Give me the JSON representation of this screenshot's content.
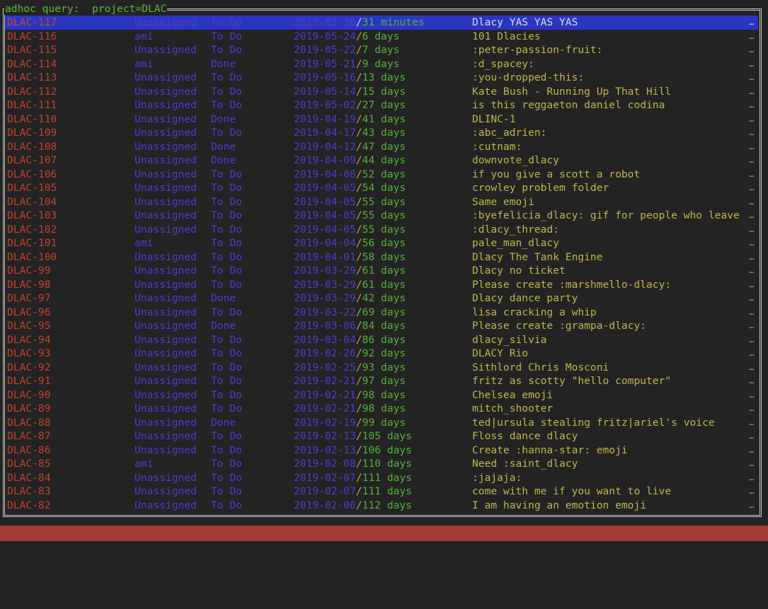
{
  "frame": {
    "title": "adhoc query:  project=DLAC"
  },
  "colors": {
    "background": "#232323",
    "border": "#c8c8c8",
    "title": "#5fb83a",
    "key": "#c4432e",
    "assignee": "#4f3bd0",
    "status": "#4f3bd0",
    "date": "#4f3bd0",
    "separator": "#b8b042",
    "age": "#54b33a",
    "summary": "#c0b64a",
    "selection": "#2a36c0",
    "statusbar": "#a33a36"
  },
  "more_glyph": "…",
  "date_separator": "/",
  "selected_index": 0,
  "issues": [
    {
      "key": "DLAC-117",
      "assignee": "Unassigned",
      "status": "To Do",
      "date": "2019-05-30",
      "age": "31 minutes",
      "summary": "Dlacy YAS YAS YAS"
    },
    {
      "key": "DLAC-116",
      "assignee": "ami",
      "status": "To Do",
      "date": "2019-05-24",
      "age": "6 days",
      "summary": "101 Dlacies"
    },
    {
      "key": "DLAC-115",
      "assignee": "Unassigned",
      "status": "To Do",
      "date": "2019-05-22",
      "age": "7 days",
      "summary": ":peter-passion-fruit:"
    },
    {
      "key": "DLAC-114",
      "assignee": "ami",
      "status": "Done",
      "date": "2019-05-21",
      "age": "9 days",
      "summary": ":d_spacey:"
    },
    {
      "key": "DLAC-113",
      "assignee": "Unassigned",
      "status": "To Do",
      "date": "2019-05-16",
      "age": "13 days",
      "summary": ":you-dropped-this:"
    },
    {
      "key": "DLAC-112",
      "assignee": "Unassigned",
      "status": "To Do",
      "date": "2019-05-14",
      "age": "15 days",
      "summary": "Kate Bush - Running Up That Hill"
    },
    {
      "key": "DLAC-111",
      "assignee": "Unassigned",
      "status": "To Do",
      "date": "2019-05-02",
      "age": "27 days",
      "summary": "is this reggaeton daniel codina"
    },
    {
      "key": "DLAC-110",
      "assignee": "Unassigned",
      "status": "Done",
      "date": "2019-04-19",
      "age": "41 days",
      "summary": "DLINC-1"
    },
    {
      "key": "DLAC-109",
      "assignee": "Unassigned",
      "status": "To Do",
      "date": "2019-04-17",
      "age": "43 days",
      "summary": ":abc_adrien:"
    },
    {
      "key": "DLAC-108",
      "assignee": "Unassigned",
      "status": "Done",
      "date": "2019-04-12",
      "age": "47 days",
      "summary": ":cutnam:"
    },
    {
      "key": "DLAC-107",
      "assignee": "Unassigned",
      "status": "Done",
      "date": "2019-04-09",
      "age": "44 days",
      "summary": "downvote_dlacy"
    },
    {
      "key": "DLAC-106",
      "assignee": "Unassigned",
      "status": "To Do",
      "date": "2019-04-08",
      "age": "52 days",
      "summary": "if you give a scott a robot"
    },
    {
      "key": "DLAC-105",
      "assignee": "Unassigned",
      "status": "To Do",
      "date": "2019-04-05",
      "age": "54 days",
      "summary": "crowley problem folder"
    },
    {
      "key": "DLAC-104",
      "assignee": "Unassigned",
      "status": "To Do",
      "date": "2019-04-05",
      "age": "55 days",
      "summary": "Same emoji"
    },
    {
      "key": "DLAC-103",
      "assignee": "Unassigned",
      "status": "To Do",
      "date": "2019-04-05",
      "age": "55 days",
      "summary": ":byefelicia_dlacy: gif for people who leave"
    },
    {
      "key": "DLAC-102",
      "assignee": "Unassigned",
      "status": "To Do",
      "date": "2019-04-05",
      "age": "55 days",
      "summary": ":dlacy_thread:"
    },
    {
      "key": "DLAC-101",
      "assignee": "ami",
      "status": "To Do",
      "date": "2019-04-04",
      "age": "56 days",
      "summary": "pale_man_dlacy"
    },
    {
      "key": "DLAC-100",
      "assignee": "Unassigned",
      "status": "To Do",
      "date": "2019-04-01",
      "age": "58 days",
      "summary": "Dlacy The Tank Engine"
    },
    {
      "key": "DLAC-99",
      "assignee": "Unassigned",
      "status": "To Do",
      "date": "2019-03-29",
      "age": "61 days",
      "summary": "Dlacy no ticket"
    },
    {
      "key": "DLAC-98",
      "assignee": "Unassigned",
      "status": "To Do",
      "date": "2019-03-29",
      "age": "61 days",
      "summary": "Please create :marshmello-dlacy:"
    },
    {
      "key": "DLAC-97",
      "assignee": "Unassigned",
      "status": "Done",
      "date": "2019-03-29",
      "age": "42 days",
      "summary": "Dlacy dance party"
    },
    {
      "key": "DLAC-96",
      "assignee": "Unassigned",
      "status": "To Do",
      "date": "2019-03-22",
      "age": "69 days",
      "summary": "lisa cracking a whip"
    },
    {
      "key": "DLAC-95",
      "assignee": "Unassigned",
      "status": "Done",
      "date": "2019-03-06",
      "age": "84 days",
      "summary": "Please create :grampa-dlacy:"
    },
    {
      "key": "DLAC-94",
      "assignee": "Unassigned",
      "status": "To Do",
      "date": "2019-03-04",
      "age": "86 days",
      "summary": "dlacy_silvia"
    },
    {
      "key": "DLAC-93",
      "assignee": "Unassigned",
      "status": "To Do",
      "date": "2019-02-26",
      "age": "92 days",
      "summary": "DLACY Rio"
    },
    {
      "key": "DLAC-92",
      "assignee": "Unassigned",
      "status": "To Do",
      "date": "2019-02-25",
      "age": "93 days",
      "summary": "Sithlord Chris Mosconi"
    },
    {
      "key": "DLAC-91",
      "assignee": "Unassigned",
      "status": "To Do",
      "date": "2019-02-21",
      "age": "97 days",
      "summary": "fritz as scotty \"hello computer\""
    },
    {
      "key": "DLAC-90",
      "assignee": "Unassigned",
      "status": "To Do",
      "date": "2019-02-21",
      "age": "98 days",
      "summary": "Chelsea emoji"
    },
    {
      "key": "DLAC-89",
      "assignee": "Unassigned",
      "status": "To Do",
      "date": "2019-02-21",
      "age": "98 days",
      "summary": "mitch_shooter"
    },
    {
      "key": "DLAC-88",
      "assignee": "Unassigned",
      "status": "Done",
      "date": "2019-02-19",
      "age": "99 days",
      "summary": "ted|ursula stealing fritz|ariel's voice"
    },
    {
      "key": "DLAC-87",
      "assignee": "Unassigned",
      "status": "To Do",
      "date": "2019-02-13",
      "age": "105 days",
      "summary": "Floss dance dlacy"
    },
    {
      "key": "DLAC-86",
      "assignee": "Unassigned",
      "status": "To Do",
      "date": "2019-02-13",
      "age": "106 days",
      "summary": "Create :hanna-star: emoji"
    },
    {
      "key": "DLAC-85",
      "assignee": "ami",
      "status": "To Do",
      "date": "2019-02-08",
      "age": "110 days",
      "summary": "Need :saint_dlacy"
    },
    {
      "key": "DLAC-84",
      "assignee": "Unassigned",
      "status": "To Do",
      "date": "2019-02-07",
      "age": "111 days",
      "summary": ":jajaja:"
    },
    {
      "key": "DLAC-83",
      "assignee": "Unassigned",
      "status": "To Do",
      "date": "2019-02-07",
      "age": "111 days",
      "summary": "come with me if you want to live"
    },
    {
      "key": "DLAC-82",
      "assignee": "Unassigned",
      "status": "To Do",
      "date": "2019-02-06",
      "age": "112 days",
      "summary": "I am having an emotion emoji"
    }
  ],
  "statusbar": {
    "text": ""
  }
}
